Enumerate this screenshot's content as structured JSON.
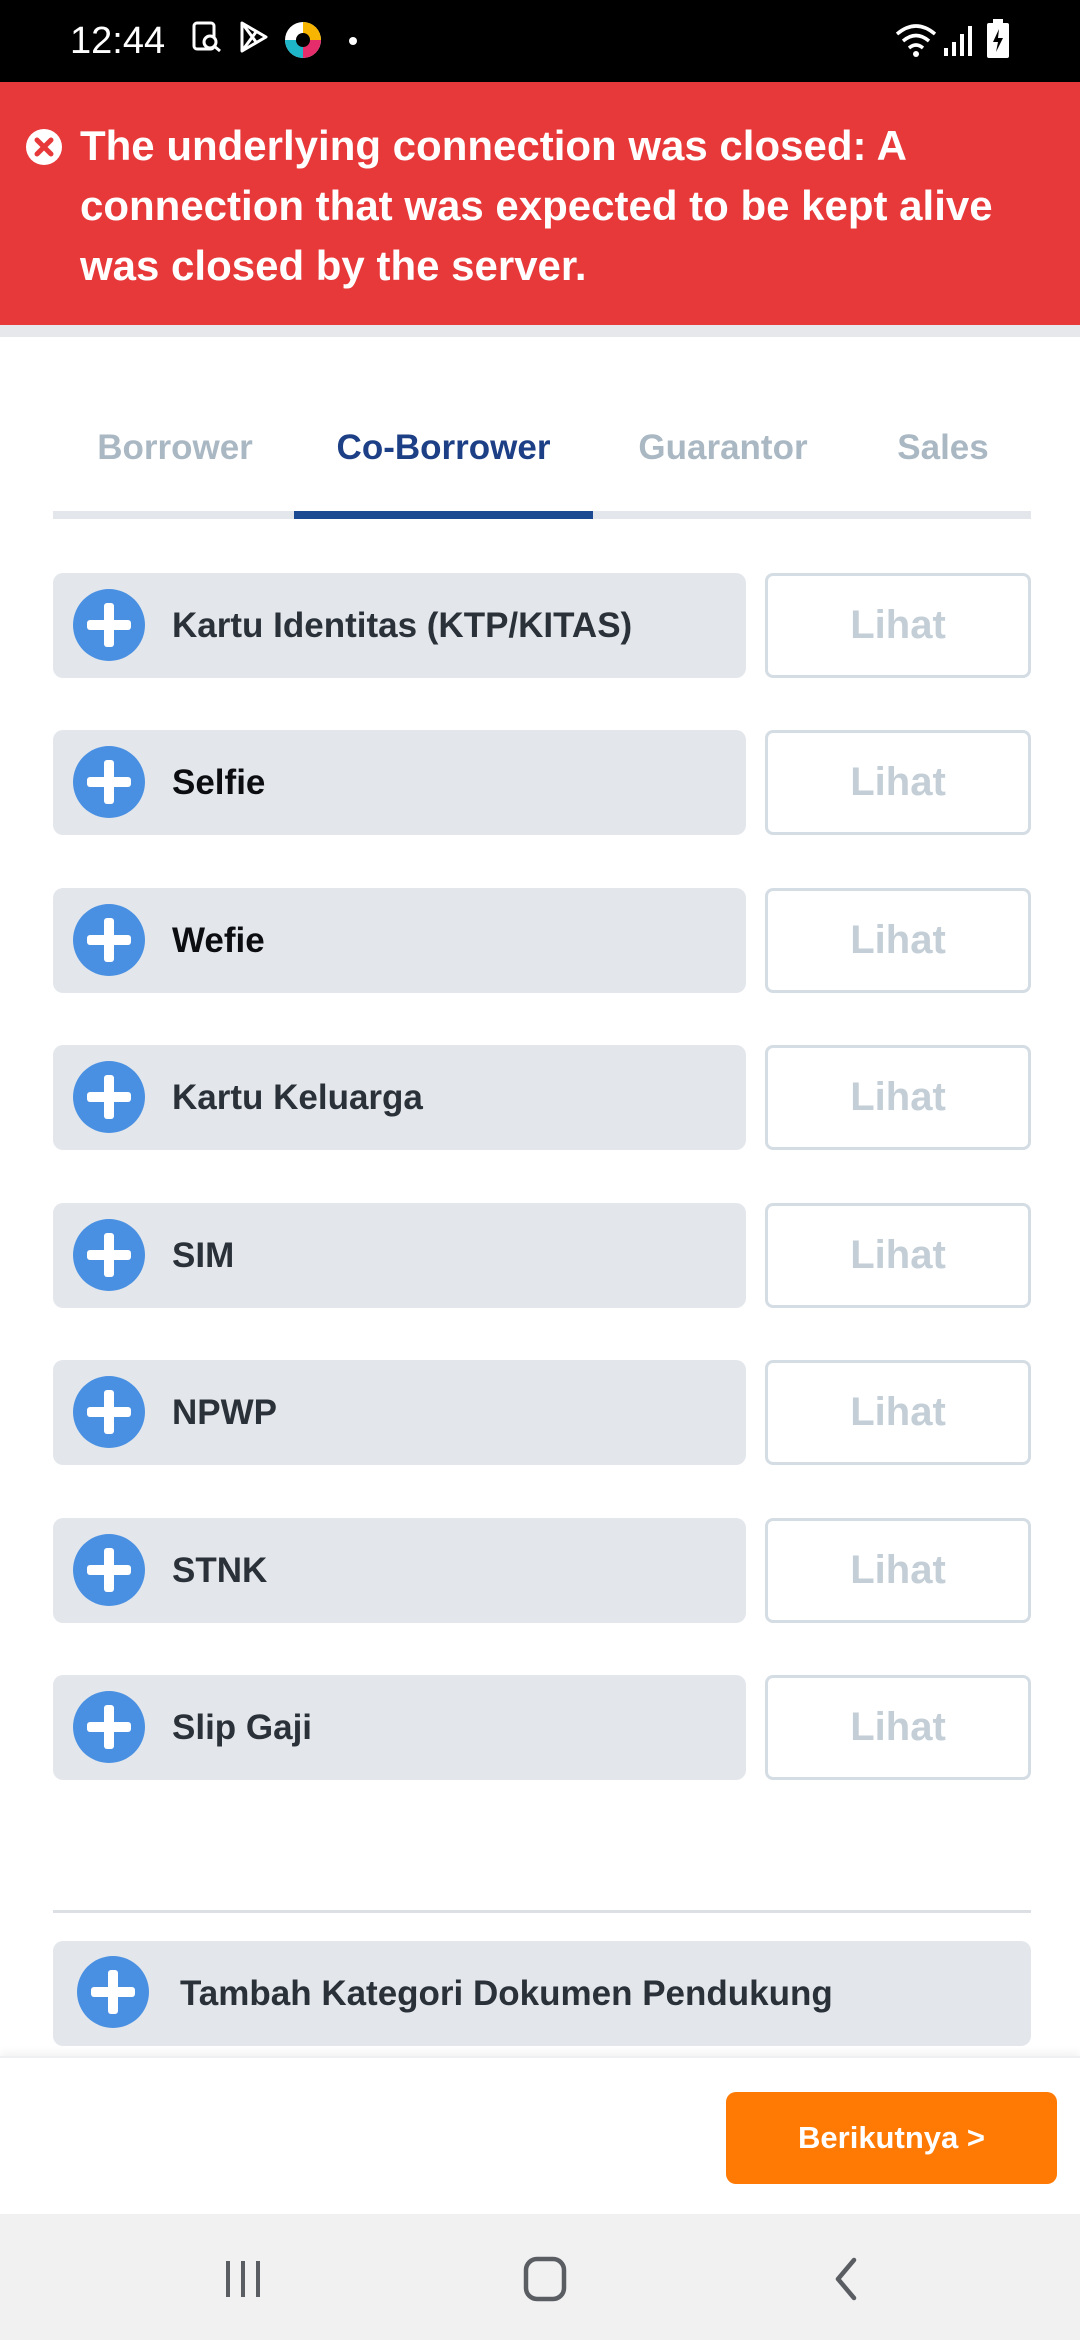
{
  "status_bar": {
    "time": "12:44",
    "left_icons": [
      "screenshot-icon",
      "play-store-icon",
      "app-icon",
      "dot-icon"
    ],
    "right_icons": [
      "wifi-icon",
      "signal-icon",
      "battery-icon"
    ]
  },
  "error": {
    "message": "The underlying connection was closed: A connection that was expected to be kept alive was closed by the server.",
    "icon": "close-circle-icon",
    "color": "#e8393a"
  },
  "tabs": [
    {
      "label": "Borrower",
      "active": false
    },
    {
      "label": "Co-Borrower",
      "active": true
    },
    {
      "label": "Guarantor",
      "active": false
    },
    {
      "label": "Sales",
      "active": false
    }
  ],
  "documents": [
    {
      "label": "Kartu Identitas (KTP/KITAS)",
      "action": "Lihat"
    },
    {
      "label": "Selfie",
      "action": "Lihat"
    },
    {
      "label": "Wefie",
      "action": "Lihat"
    },
    {
      "label": "Kartu Keluarga",
      "action": "Lihat"
    },
    {
      "label": "SIM",
      "action": "Lihat"
    },
    {
      "label": "NPWP",
      "action": "Lihat"
    },
    {
      "label": "STNK",
      "action": "Lihat"
    },
    {
      "label": "Slip Gaji",
      "action": "Lihat"
    }
  ],
  "add_category": {
    "label": "Tambah Kategori Dokumen Pendukung"
  },
  "next_button": {
    "label": "Berikutnya >",
    "color": "#ff7a05"
  },
  "nav_bar": {
    "icons": [
      "recent-apps-icon",
      "home-icon",
      "back-icon"
    ]
  },
  "colors": {
    "accent": "#1c3f86",
    "plus": "#4a90e2",
    "pill": "#e3e7ec"
  }
}
